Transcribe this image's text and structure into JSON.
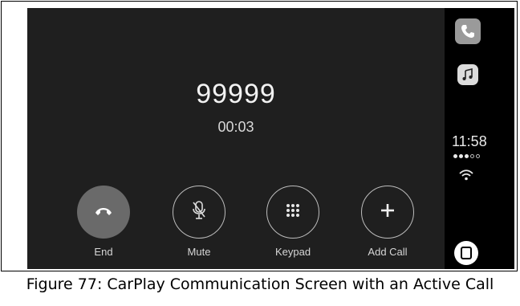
{
  "call": {
    "number": "99999",
    "duration": "00:03"
  },
  "controls": [
    {
      "label": "End",
      "icon": "end-call-icon"
    },
    {
      "label": "Mute",
      "icon": "microphone-muted-icon"
    },
    {
      "label": "Keypad",
      "icon": "keypad-icon"
    },
    {
      "label": "Add Call",
      "icon": "plus-icon"
    }
  ],
  "status": {
    "time": "11:58",
    "signal_bars_filled": 3,
    "signal_bars_total": 5
  },
  "sidebar_apps": [
    "phone-icon",
    "music-icon"
  ],
  "caption": "Figure 77: CarPlay Communication Screen with an Active Call",
  "colors": {
    "screen_bg": "#1f1f1f",
    "sidebar_bg": "#000000",
    "end_button": "#6a6a6a"
  }
}
